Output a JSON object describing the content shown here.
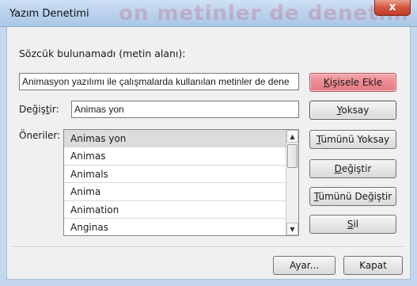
{
  "window": {
    "title": "Yazım Denetimi",
    "background_title": "on metinler de denetim",
    "close_glyph": "x"
  },
  "not_found": {
    "label": "Sözcük bulunamadı (metin alanı):",
    "context_text": "Animasyon yazılımı ile çalışmalarda kullanılan metinler de dene"
  },
  "change_to": {
    "label_prefix": "Değiş",
    "label_accel": "t",
    "label_suffix": "ir:",
    "value": "Animas yon"
  },
  "suggestions": {
    "label": "Öneriler:",
    "items": [
      "Animas yon",
      "Animas",
      "Animals",
      "Anima",
      "Animation",
      "Anginas"
    ],
    "selected_index": 0
  },
  "buttons": {
    "add_pre": "",
    "add_acc": "K",
    "add_post": "işisele Ekle",
    "ignore_pre": "",
    "ignore_acc": "Y",
    "ignore_post": "oksay",
    "ignore_all_pre": "",
    "ignore_all_acc": "T",
    "ignore_all_post": "ümünü Yoksay",
    "change_pre": "",
    "change_acc": "D",
    "change_post": "eğiştir",
    "change_all_pre": "",
    "change_all_acc": "T",
    "change_all_post": "ümünü Değiştir",
    "delete_pre": "",
    "delete_acc": "S",
    "delete_post": "il",
    "options": "Ayar...",
    "close": "Kapat"
  },
  "colors": {
    "add_button": "#ec8990",
    "title_gradient": "#b9d1ec"
  },
  "icons": {
    "scroll_up": "▲",
    "scroll_down": "▼"
  }
}
